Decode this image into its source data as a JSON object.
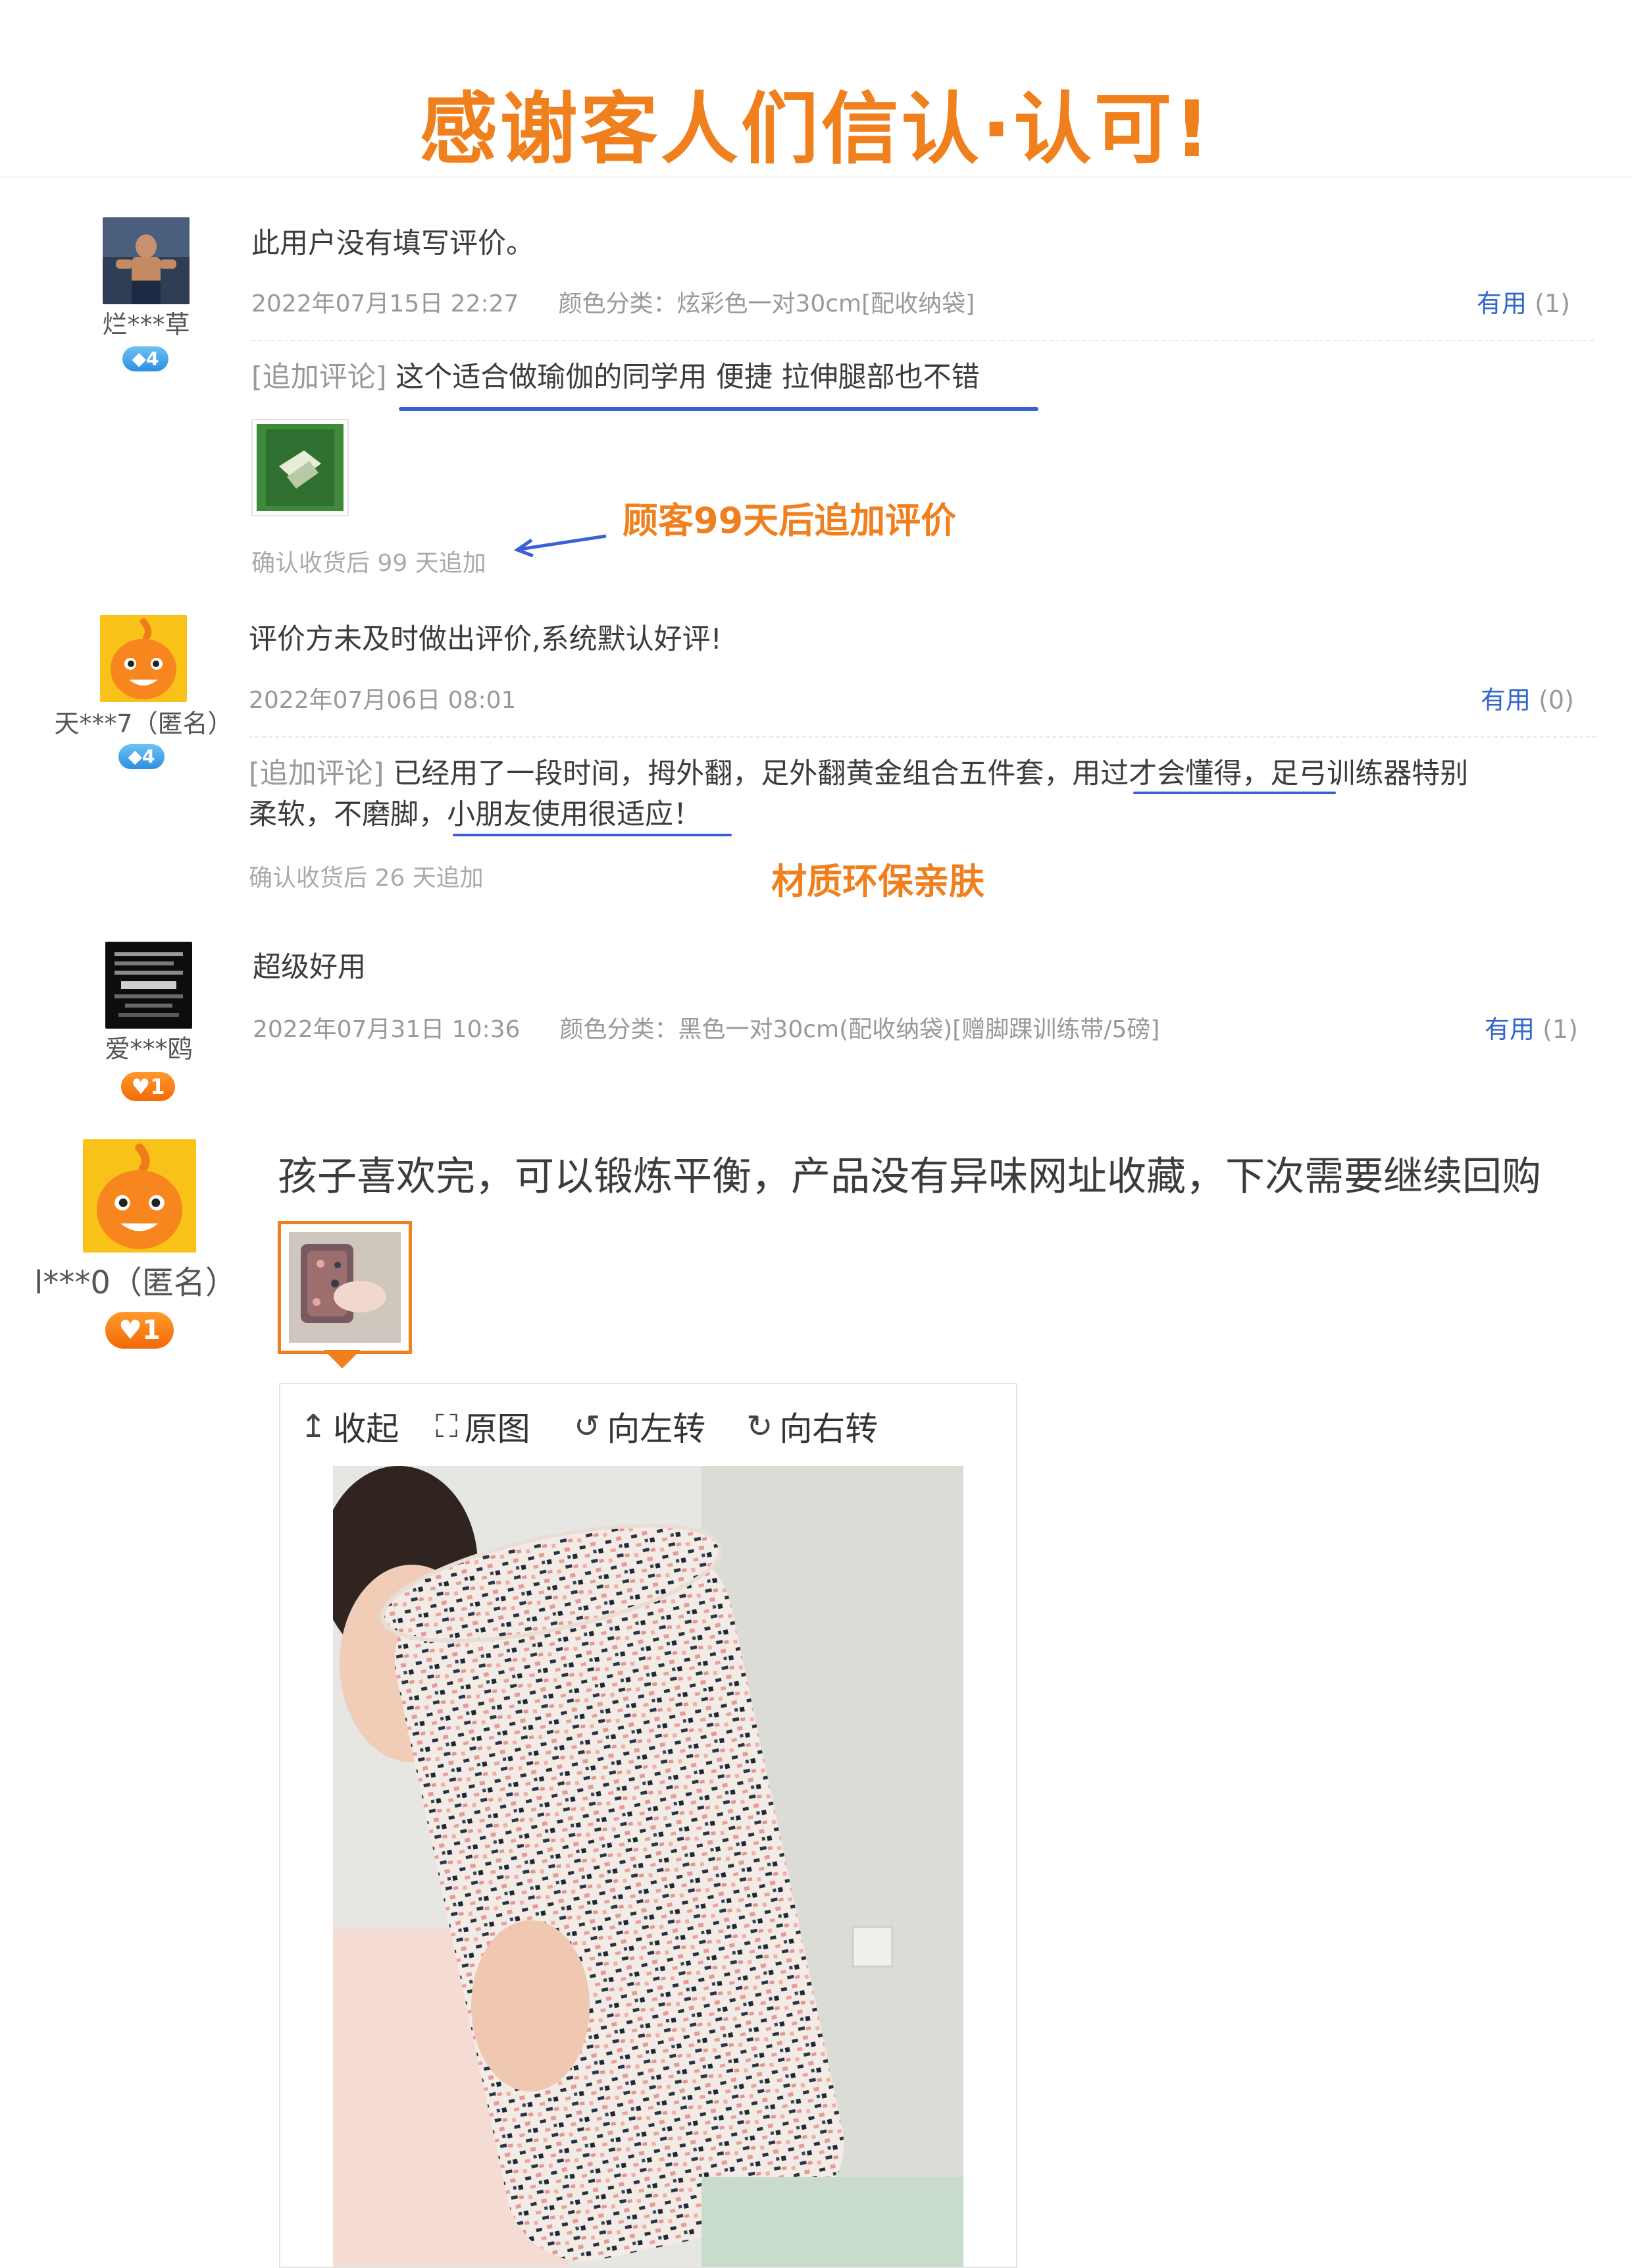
{
  "banner": {
    "title": "感谢客人们信认·认可!"
  },
  "reviews": [
    {
      "user": "烂***草",
      "badge": "4",
      "text": "此用户没有填写评价。",
      "date": "2022年07月15日 22:27",
      "sku": "颜色分类：炫彩色一对30cm[配收纳袋]",
      "useful_label": "有用",
      "useful_count": "(1)",
      "append_tag": "[追加评论]",
      "append_text": "这个适合做瑜伽的同学用 便捷 拉伸腿部也不错",
      "confirm": "确认收货后 99 天追加",
      "annotation": "顾客99天后追加评价"
    },
    {
      "user": "天***7（匿名）",
      "badge": "4",
      "text": "评价方未及时做出评价,系统默认好评!",
      "date": "2022年07月06日 08:01",
      "useful_label": "有用",
      "useful_count": "(0)",
      "append_tag": "[追加评论]",
      "append_line1_a": "已经用了一段时间，拇外翻，足外翻黄金组合五件套，",
      "append_line1_u": "用过才会懂得",
      "append_line1_b": "，足弓训练器特别",
      "append_line2_a": "柔软，不磨脚，",
      "append_line2_u": "小朋友使用很适应！",
      "confirm": "确认收货后 26 天追加",
      "annotation": "材质环保亲肤"
    },
    {
      "user": "爱***鸥",
      "badge": "1",
      "text": "超级好用",
      "date": "2022年07月31日 10:36",
      "sku": "颜色分类：黑色一对30cm(配收纳袋)[赠脚踝训练带/5磅]",
      "useful_label": "有用",
      "useful_count": "(1)"
    },
    {
      "user": "l***0（匿名）",
      "badge": "1",
      "text": "孩子喜欢完，可以锻炼平衡，产品没有异味网址收藏，下次需要继续回购"
    }
  ],
  "viewer": {
    "collapse": "收起",
    "original": "原图",
    "rotate_left": "向左转",
    "rotate_right": "向右转"
  },
  "colors": {
    "accent": "#f07f1d",
    "link": "#3366cc",
    "underline": "#3a5fd6"
  },
  "icons": [
    "collapse-arrow-icon",
    "fullscreen-icon",
    "rotate-left-icon",
    "rotate-right-icon",
    "diamond-badge-icon",
    "heart-badge-icon"
  ]
}
